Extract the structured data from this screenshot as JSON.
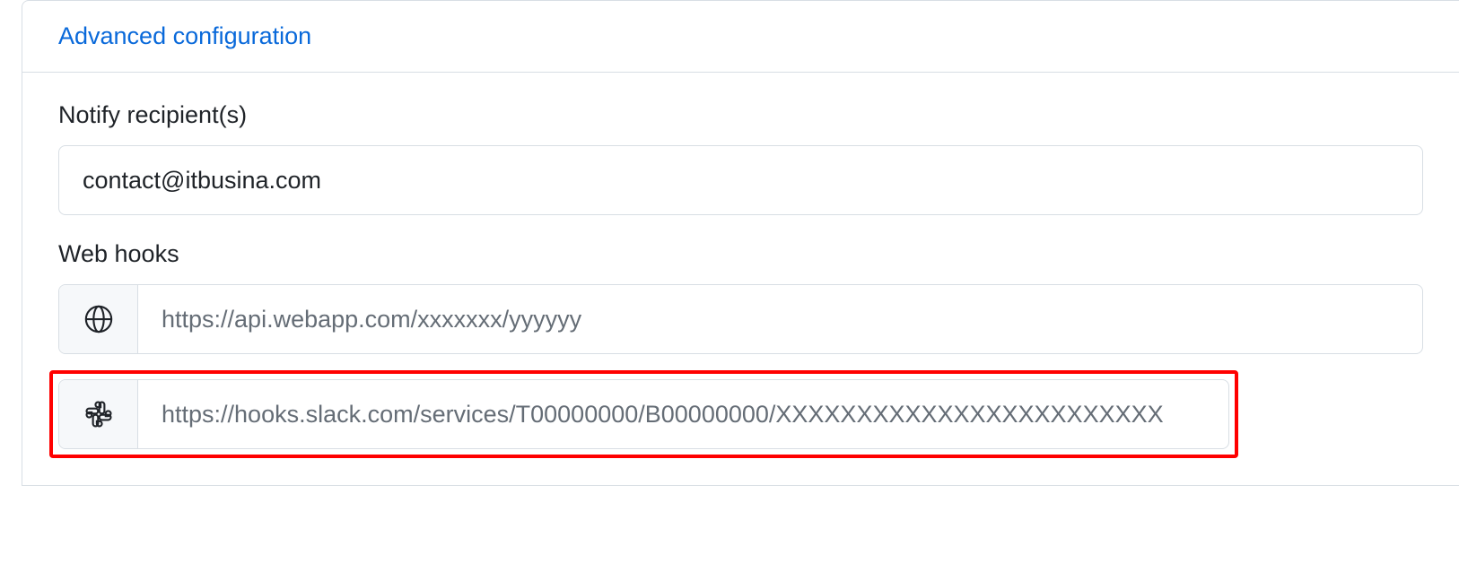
{
  "header": {
    "title": "Advanced configuration"
  },
  "recipients": {
    "label": "Notify recipient(s)",
    "value": "contact@itbusina.com"
  },
  "webhooks": {
    "label": "Web hooks",
    "items": [
      {
        "icon": "globe-icon",
        "placeholder": "https://api.webapp.com/xxxxxxx/yyyyyy",
        "value": ""
      },
      {
        "icon": "slack-icon",
        "placeholder": "https://hooks.slack.com/services/T00000000/B00000000/XXXXXXXXXXXXXXXXXXXXXXXX",
        "value": ""
      }
    ]
  }
}
